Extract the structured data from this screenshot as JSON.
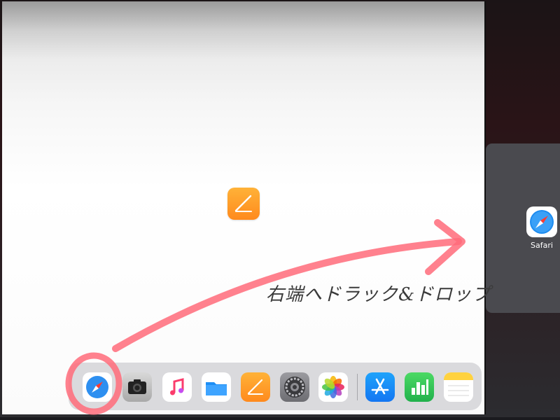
{
  "main_app": {
    "name_icon": "pages-icon"
  },
  "slideover": {
    "app_label": "Safari",
    "icon": "safari-icon"
  },
  "dock": {
    "apps": [
      {
        "name": "safari-icon"
      },
      {
        "name": "camera-icon"
      },
      {
        "name": "music-icon"
      },
      {
        "name": "files-icon"
      },
      {
        "name": "pages-icon"
      },
      {
        "name": "settings-icon"
      },
      {
        "name": "photos-icon"
      },
      {
        "name": "app-store-icon"
      },
      {
        "name": "numbers-icon"
      },
      {
        "name": "notes-icon"
      }
    ]
  },
  "annotation": {
    "text": "右端へドラック&ドロップ",
    "color": "#ff6b7a"
  }
}
